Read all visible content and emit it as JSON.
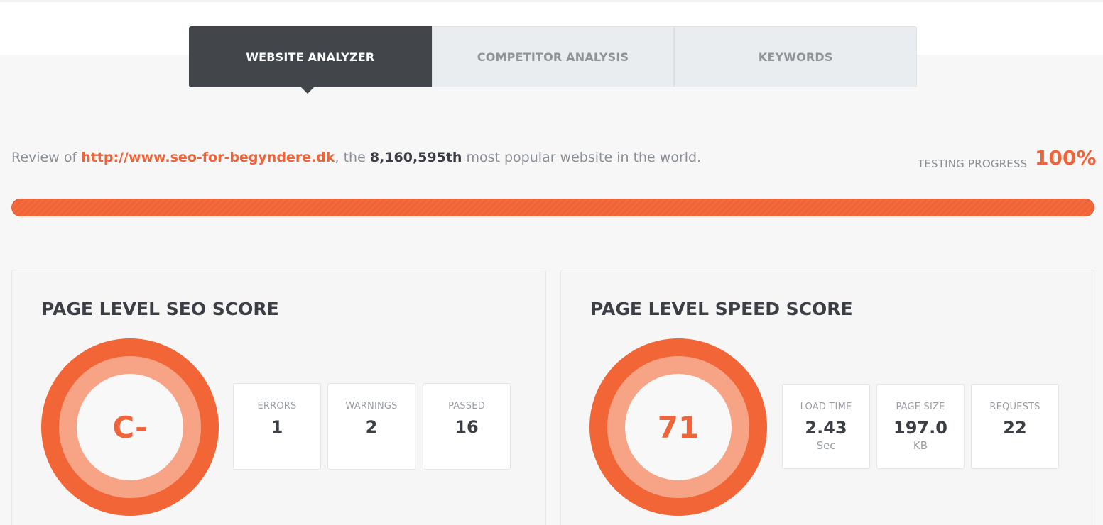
{
  "tabs": [
    {
      "label": "WEBSITE ANALYZER",
      "active": true
    },
    {
      "label": "COMPETITOR ANALYSIS",
      "active": false
    },
    {
      "label": "KEYWORDS",
      "active": false
    }
  ],
  "review": {
    "prefix": "Review of ",
    "url": "http://www.seo-for-begyndere.dk",
    "middle": ", the ",
    "rank": "8,160,595th",
    "suffix": " most popular website in the world."
  },
  "progress": {
    "label": "TESTING PROGRESS",
    "value_text": "100%",
    "percent": 100
  },
  "seo_panel": {
    "title": "PAGE LEVEL SEO SCORE",
    "grade": "C-",
    "stats": [
      {
        "label": "ERRORS",
        "value": "1"
      },
      {
        "label": "WARNINGS",
        "value": "2"
      },
      {
        "label": "PASSED",
        "value": "16"
      }
    ]
  },
  "speed_panel": {
    "title": "PAGE LEVEL SPEED SCORE",
    "score": "71",
    "stats": [
      {
        "label": "LOAD TIME",
        "value": "2.43",
        "unit": "Sec"
      },
      {
        "label": "PAGE SIZE",
        "value": "197.0",
        "unit": "KB"
      },
      {
        "label": "REQUESTS",
        "value": "22"
      }
    ]
  },
  "colors": {
    "accent": "#f0643a",
    "dark_tab": "#424549",
    "ring_mid": "#f7a486"
  }
}
